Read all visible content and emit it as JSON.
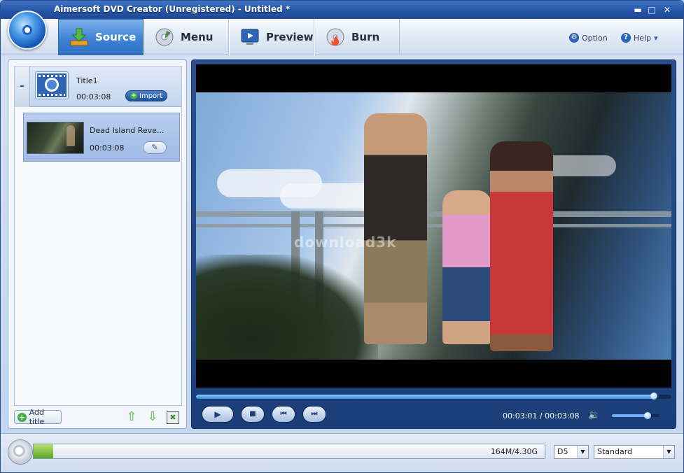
{
  "window": {
    "title": "Aimersoft DVD Creator (Unregistered) - Untitled *",
    "minimize": "▬",
    "maximize": "□",
    "close": "✕"
  },
  "tabs": [
    {
      "label": "Source",
      "icon": "download-arrow-icon",
      "active": true
    },
    {
      "label": "Menu",
      "icon": "disc-menu-icon",
      "active": false
    },
    {
      "label": "Preview",
      "icon": "monitor-play-icon",
      "active": false
    },
    {
      "label": "Burn",
      "icon": "burn-disc-icon",
      "active": false
    }
  ],
  "toplinks": {
    "option": "Option",
    "help": "Help",
    "help_arrow": "▾"
  },
  "source": {
    "collapse": "–",
    "title": {
      "name": "Title1",
      "duration": "00:03:08"
    },
    "import_label": "Import",
    "clip": {
      "name": "Dead Island Reve...",
      "duration": "00:03:08"
    },
    "add_title_label": "Add title",
    "move_up": "⇧",
    "move_down": "⇩",
    "delete": "✖"
  },
  "player": {
    "watermark": "download3k",
    "current_time": "00:03:01",
    "separator": "/",
    "total_time": "00:03:08",
    "progress_fraction": 0.9628,
    "volume_fraction": 0.75,
    "play": "▶",
    "stop": "■",
    "prev": "⏮",
    "next": "⏭",
    "volume_icon": "🔉"
  },
  "status": {
    "capacity_text": "164M/4.30G",
    "capacity_fraction": 0.038,
    "disc_type": "D5",
    "quality": "Standard",
    "dropdown": "▼"
  },
  "colors": {
    "accent": "#2f70c2",
    "player_bg": "#1b3e78",
    "capacity_fill": "#5aa62a"
  }
}
